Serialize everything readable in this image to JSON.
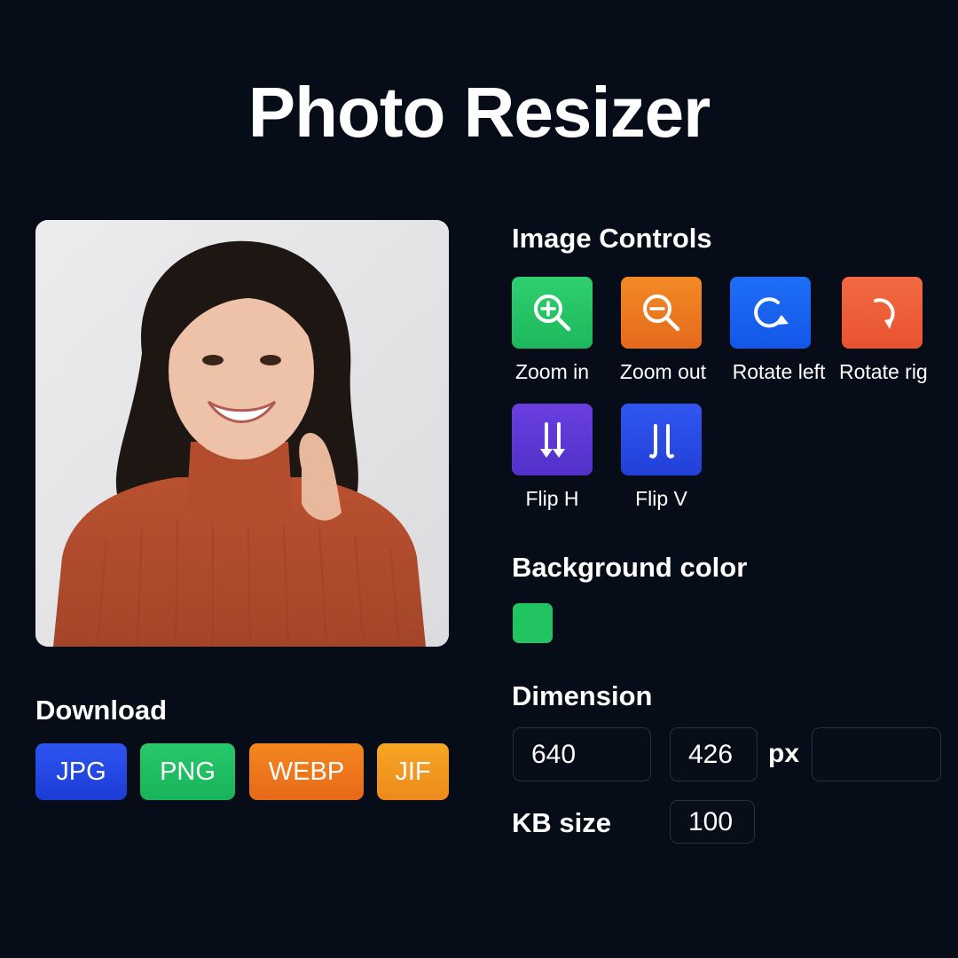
{
  "app": {
    "title": "Photo Resizer"
  },
  "download": {
    "heading": "Download",
    "formats": [
      "JPG",
      "PNG",
      "WEBP",
      "JIF"
    ]
  },
  "image_controls": {
    "heading": "Image Controls",
    "buttons": [
      {
        "label": "Zoom in",
        "icon": "zoom-in-icon",
        "color": "#22c462"
      },
      {
        "label": "Zoom out",
        "icon": "zoom-out-icon",
        "color": "#ea751f"
      },
      {
        "label": "Rotate left",
        "icon": "rotate-left-icon",
        "color": "#1862f0"
      },
      {
        "label": "Rotate rig",
        "icon": "rotate-right-icon",
        "color": "#ec5c38"
      },
      {
        "label": "Flip H",
        "icon": "flip-horizontal-icon",
        "color": "#5c36d4"
      },
      {
        "label": "Flip V",
        "icon": "flip-vertical-icon",
        "color": "#2a4ae3"
      }
    ]
  },
  "background": {
    "heading": "Background color",
    "selected_color": "#22c462"
  },
  "dimension": {
    "heading": "Dimension",
    "width": "640",
    "height": "426",
    "unit": "px",
    "extra": ""
  },
  "kb_size": {
    "label": "KB size",
    "value": "100"
  },
  "colors": {
    "background": "#060c18",
    "text": "#ffffff",
    "input_border": "#2a3140"
  }
}
